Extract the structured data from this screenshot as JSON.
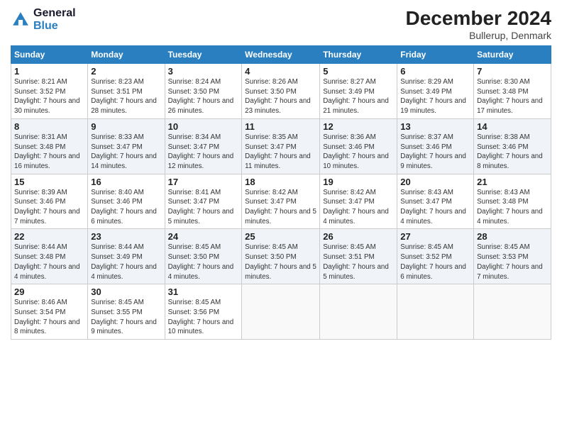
{
  "header": {
    "logo_line1": "General",
    "logo_line2": "Blue",
    "month": "December 2024",
    "location": "Bullerup, Denmark"
  },
  "weekdays": [
    "Sunday",
    "Monday",
    "Tuesday",
    "Wednesday",
    "Thursday",
    "Friday",
    "Saturday"
  ],
  "weeks": [
    [
      {
        "day": "1",
        "sunrise": "8:21 AM",
        "sunset": "3:52 PM",
        "daylight": "7 hours and 30 minutes."
      },
      {
        "day": "2",
        "sunrise": "8:23 AM",
        "sunset": "3:51 PM",
        "daylight": "7 hours and 28 minutes."
      },
      {
        "day": "3",
        "sunrise": "8:24 AM",
        "sunset": "3:50 PM",
        "daylight": "7 hours and 26 minutes."
      },
      {
        "day": "4",
        "sunrise": "8:26 AM",
        "sunset": "3:50 PM",
        "daylight": "7 hours and 23 minutes."
      },
      {
        "day": "5",
        "sunrise": "8:27 AM",
        "sunset": "3:49 PM",
        "daylight": "7 hours and 21 minutes."
      },
      {
        "day": "6",
        "sunrise": "8:29 AM",
        "sunset": "3:49 PM",
        "daylight": "7 hours and 19 minutes."
      },
      {
        "day": "7",
        "sunrise": "8:30 AM",
        "sunset": "3:48 PM",
        "daylight": "7 hours and 17 minutes."
      }
    ],
    [
      {
        "day": "8",
        "sunrise": "8:31 AM",
        "sunset": "3:48 PM",
        "daylight": "7 hours and 16 minutes."
      },
      {
        "day": "9",
        "sunrise": "8:33 AM",
        "sunset": "3:47 PM",
        "daylight": "7 hours and 14 minutes."
      },
      {
        "day": "10",
        "sunrise": "8:34 AM",
        "sunset": "3:47 PM",
        "daylight": "7 hours and 12 minutes."
      },
      {
        "day": "11",
        "sunrise": "8:35 AM",
        "sunset": "3:47 PM",
        "daylight": "7 hours and 11 minutes."
      },
      {
        "day": "12",
        "sunrise": "8:36 AM",
        "sunset": "3:46 PM",
        "daylight": "7 hours and 10 minutes."
      },
      {
        "day": "13",
        "sunrise": "8:37 AM",
        "sunset": "3:46 PM",
        "daylight": "7 hours and 9 minutes."
      },
      {
        "day": "14",
        "sunrise": "8:38 AM",
        "sunset": "3:46 PM",
        "daylight": "7 hours and 8 minutes."
      }
    ],
    [
      {
        "day": "15",
        "sunrise": "8:39 AM",
        "sunset": "3:46 PM",
        "daylight": "7 hours and 7 minutes."
      },
      {
        "day": "16",
        "sunrise": "8:40 AM",
        "sunset": "3:46 PM",
        "daylight": "7 hours and 6 minutes."
      },
      {
        "day": "17",
        "sunrise": "8:41 AM",
        "sunset": "3:47 PM",
        "daylight": "7 hours and 5 minutes."
      },
      {
        "day": "18",
        "sunrise": "8:42 AM",
        "sunset": "3:47 PM",
        "daylight": "7 hours and 5 minutes."
      },
      {
        "day": "19",
        "sunrise": "8:42 AM",
        "sunset": "3:47 PM",
        "daylight": "7 hours and 4 minutes."
      },
      {
        "day": "20",
        "sunrise": "8:43 AM",
        "sunset": "3:47 PM",
        "daylight": "7 hours and 4 minutes."
      },
      {
        "day": "21",
        "sunrise": "8:43 AM",
        "sunset": "3:48 PM",
        "daylight": "7 hours and 4 minutes."
      }
    ],
    [
      {
        "day": "22",
        "sunrise": "8:44 AM",
        "sunset": "3:48 PM",
        "daylight": "7 hours and 4 minutes."
      },
      {
        "day": "23",
        "sunrise": "8:44 AM",
        "sunset": "3:49 PM",
        "daylight": "7 hours and 4 minutes."
      },
      {
        "day": "24",
        "sunrise": "8:45 AM",
        "sunset": "3:50 PM",
        "daylight": "7 hours and 4 minutes."
      },
      {
        "day": "25",
        "sunrise": "8:45 AM",
        "sunset": "3:50 PM",
        "daylight": "7 hours and 5 minutes."
      },
      {
        "day": "26",
        "sunrise": "8:45 AM",
        "sunset": "3:51 PM",
        "daylight": "7 hours and 5 minutes."
      },
      {
        "day": "27",
        "sunrise": "8:45 AM",
        "sunset": "3:52 PM",
        "daylight": "7 hours and 6 minutes."
      },
      {
        "day": "28",
        "sunrise": "8:45 AM",
        "sunset": "3:53 PM",
        "daylight": "7 hours and 7 minutes."
      }
    ],
    [
      {
        "day": "29",
        "sunrise": "8:46 AM",
        "sunset": "3:54 PM",
        "daylight": "7 hours and 8 minutes."
      },
      {
        "day": "30",
        "sunrise": "8:45 AM",
        "sunset": "3:55 PM",
        "daylight": "7 hours and 9 minutes."
      },
      {
        "day": "31",
        "sunrise": "8:45 AM",
        "sunset": "3:56 PM",
        "daylight": "7 hours and 10 minutes."
      },
      null,
      null,
      null,
      null
    ]
  ]
}
